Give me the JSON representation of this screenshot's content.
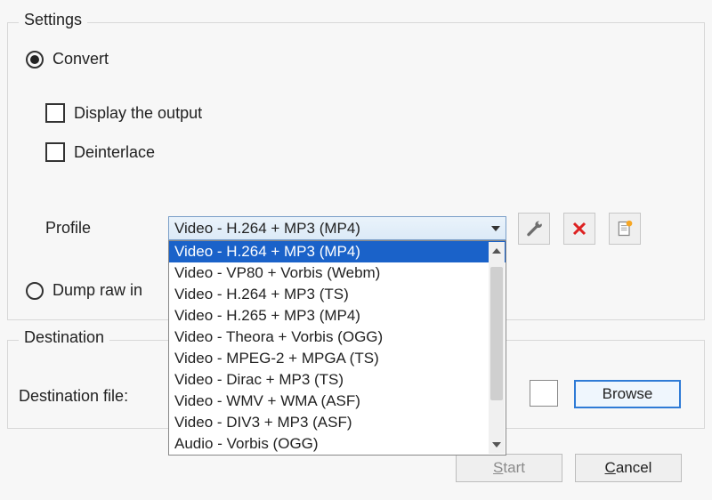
{
  "settings": {
    "legend": "Settings",
    "convert": {
      "label": "Convert",
      "selected": true
    },
    "display_output": {
      "label": "Display the output",
      "checked": false
    },
    "deinterlace": {
      "label": "Deinterlace",
      "checked": false
    },
    "profile_label": "Profile",
    "profile_selected": "Video - H.264 + MP3 (MP4)",
    "profile_options": [
      "Video - H.264 + MP3 (MP4)",
      "Video - VP80 + Vorbis (Webm)",
      "Video - H.264 + MP3 (TS)",
      "Video - H.265 + MP3 (MP4)",
      "Video - Theora + Vorbis (OGG)",
      "Video - MPEG-2 + MPGA (TS)",
      "Video - Dirac + MP3 (TS)",
      "Video - WMV + WMA (ASF)",
      "Video - DIV3 + MP3 (ASF)",
      "Audio - Vorbis (OGG)"
    ],
    "dump_raw": {
      "label": "Dump raw in",
      "selected": false
    }
  },
  "destination": {
    "legend": "Destination",
    "file_label": "Destination file:",
    "file_value": "",
    "browse_label": "Browse"
  },
  "footer": {
    "start_label": "Start",
    "cancel_label": "Cancel"
  }
}
